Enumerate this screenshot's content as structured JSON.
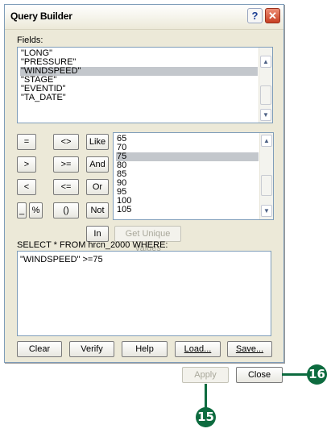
{
  "window": {
    "title": "Query Builder",
    "help_icon": "?",
    "close_icon": "✕"
  },
  "fields": {
    "label": "Fields:",
    "items": [
      "\"LONG\"",
      "\"PRESSURE\"",
      "\"WINDSPEED\"",
      "\"STAGE\"",
      "\"EVENTID\"",
      "\"TA_DATE\""
    ],
    "selected": "\"WINDSPEED\""
  },
  "operators": [
    "=",
    "<>",
    "Like",
    ">",
    ">=",
    "And",
    "<",
    "<=",
    "Or",
    "_",
    "%",
    "()",
    "Not",
    "In"
  ],
  "values": {
    "items": [
      "65",
      "70",
      "75",
      "80",
      "85",
      "90",
      "95",
      "100",
      "105"
    ],
    "selected": "75"
  },
  "get_unique_values_label": "Get Unique Values",
  "sql_prefix": "SELECT * FROM hrcn_2000 WHERE:",
  "query_text": "\"WINDSPEED\" >=75",
  "buttons": {
    "clear": "Clear",
    "verify": "Verify",
    "help": "Help",
    "load": "Load...",
    "save": "Save...",
    "apply": "Apply",
    "close": "Close"
  },
  "callouts": {
    "apply": "15",
    "close": "16"
  },
  "colors": {
    "callout": "#0d6b3f",
    "selection": "#c3c7cc",
    "border": "#7f9db9"
  }
}
